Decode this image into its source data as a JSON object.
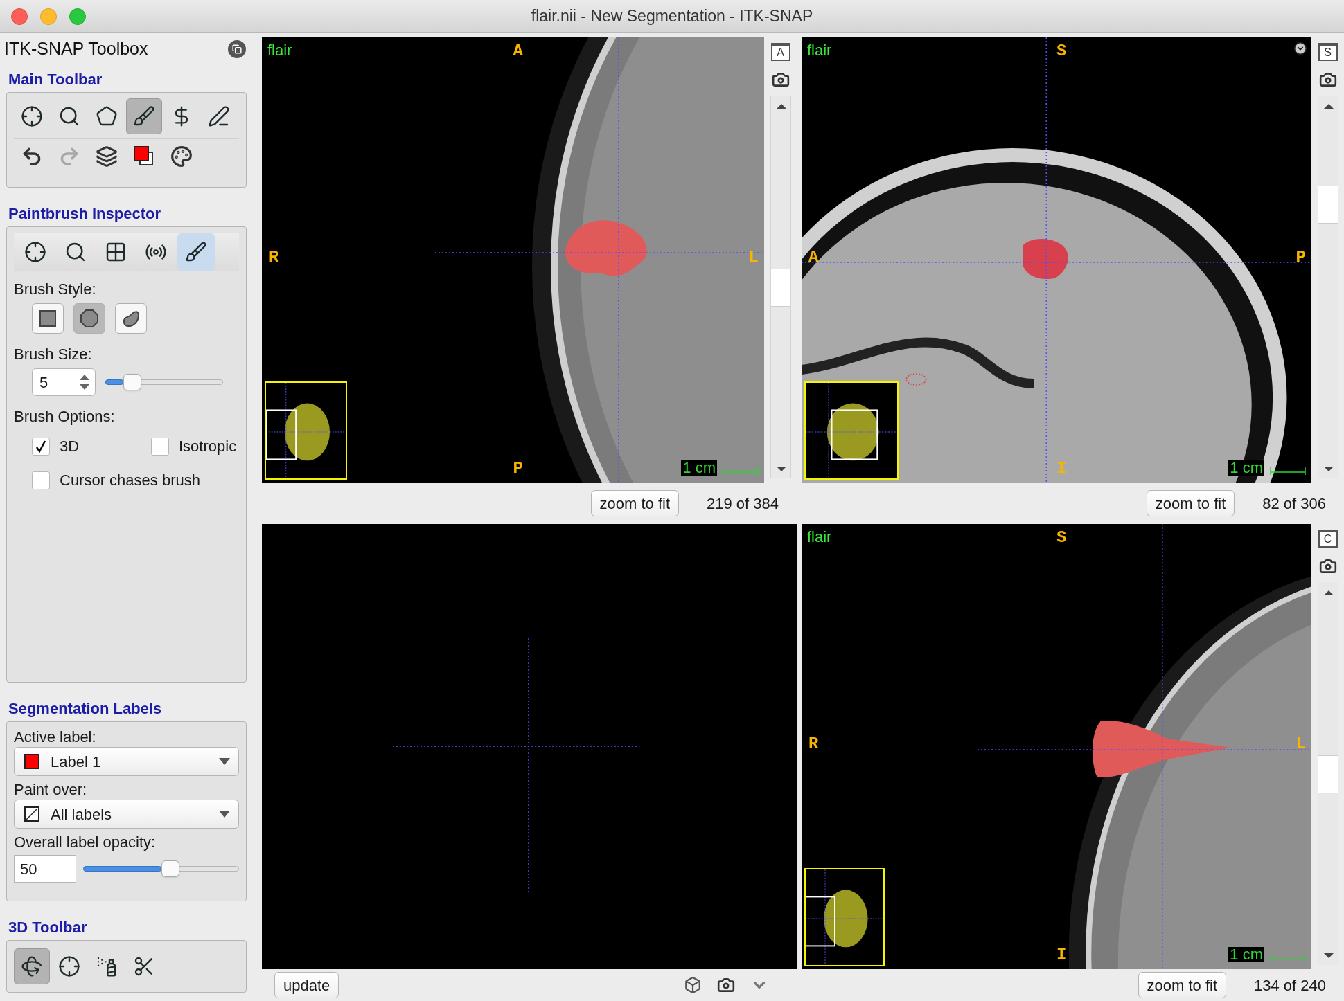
{
  "window": {
    "title": "flair.nii - New Segmentation - ITK-SNAP"
  },
  "toolbox": {
    "title": "ITK-SNAP Toolbox"
  },
  "main_toolbar": {
    "title": "Main Toolbar",
    "tools": [
      {
        "kind": "crosshair",
        "selected": false
      },
      {
        "kind": "zoom",
        "selected": false
      },
      {
        "kind": "polygon",
        "selected": false
      },
      {
        "kind": "paintbrush",
        "selected": true
      },
      {
        "kind": "snake",
        "selected": false
      },
      {
        "kind": "annotation",
        "selected": false
      }
    ],
    "actions": [
      {
        "kind": "undo",
        "disabled": false
      },
      {
        "kind": "redo",
        "disabled": true
      },
      {
        "kind": "layers",
        "disabled": false
      },
      {
        "kind": "label-color",
        "disabled": false
      },
      {
        "kind": "palette",
        "disabled": false
      }
    ]
  },
  "paintbrush_inspector": {
    "title": "Paintbrush Inspector",
    "tools": [
      {
        "kind": "crosshair",
        "selected": false
      },
      {
        "kind": "zoom",
        "selected": false
      },
      {
        "kind": "grid",
        "selected": false
      },
      {
        "kind": "radiation",
        "selected": false
      },
      {
        "kind": "paintbrush",
        "selected": true
      }
    ],
    "brush_style_label": "Brush Style:",
    "brush_styles": [
      {
        "kind": "square",
        "selected": false
      },
      {
        "kind": "round",
        "selected": true
      },
      {
        "kind": "adaptive",
        "selected": false
      }
    ],
    "brush_size_label": "Brush Size:",
    "brush_size": {
      "value": "5",
      "level": 0.15
    },
    "brush_options_label": "Brush Options:",
    "options": [
      {
        "label": "3D",
        "checked": true
      },
      {
        "label": "Isotropic",
        "checked": false
      },
      {
        "label": "Cursor chases brush",
        "checked": false
      }
    ]
  },
  "segmentation_labels": {
    "title": "Segmentation Labels",
    "active_label_label": "Active label:",
    "active_label": {
      "value": "Label 1",
      "color": "#ff0000"
    },
    "paint_over_label": "Paint over:",
    "paint_over": {
      "value": "All labels"
    },
    "opacity_label": "Overall label opacity:",
    "opacity": {
      "value": "50",
      "level": 0.5
    }
  },
  "toolbar_3d": {
    "title": "3D Toolbar",
    "tools": [
      {
        "kind": "rotate",
        "selected": true
      },
      {
        "kind": "crosshair",
        "selected": false
      },
      {
        "kind": "spray",
        "selected": false
      },
      {
        "kind": "scalpel",
        "selected": false
      }
    ]
  },
  "views": [
    {
      "kind": "axial",
      "layer": "flair",
      "top": "A",
      "bottom": "P",
      "left": "R",
      "right": "L",
      "corner_button": "A",
      "scale": "1 cm",
      "zoom_button": "zoom to fit",
      "slice": "219 of 384"
    },
    {
      "kind": "sagittal",
      "layer": "flair",
      "top": "S",
      "bottom": "I",
      "left": "A",
      "right": "P",
      "corner_button": "S",
      "scale": "1 cm",
      "zoom_button": "zoom to fit",
      "slice": "82 of 306"
    },
    {
      "kind": "volume",
      "update_button": "update"
    },
    {
      "kind": "coronal",
      "layer": "flair",
      "top": "S",
      "bottom": "I",
      "left": "R",
      "right": "L",
      "corner_button": "C",
      "scale": "1 cm",
      "zoom_button": "zoom to fit",
      "slice": "134 of 240"
    }
  ]
}
